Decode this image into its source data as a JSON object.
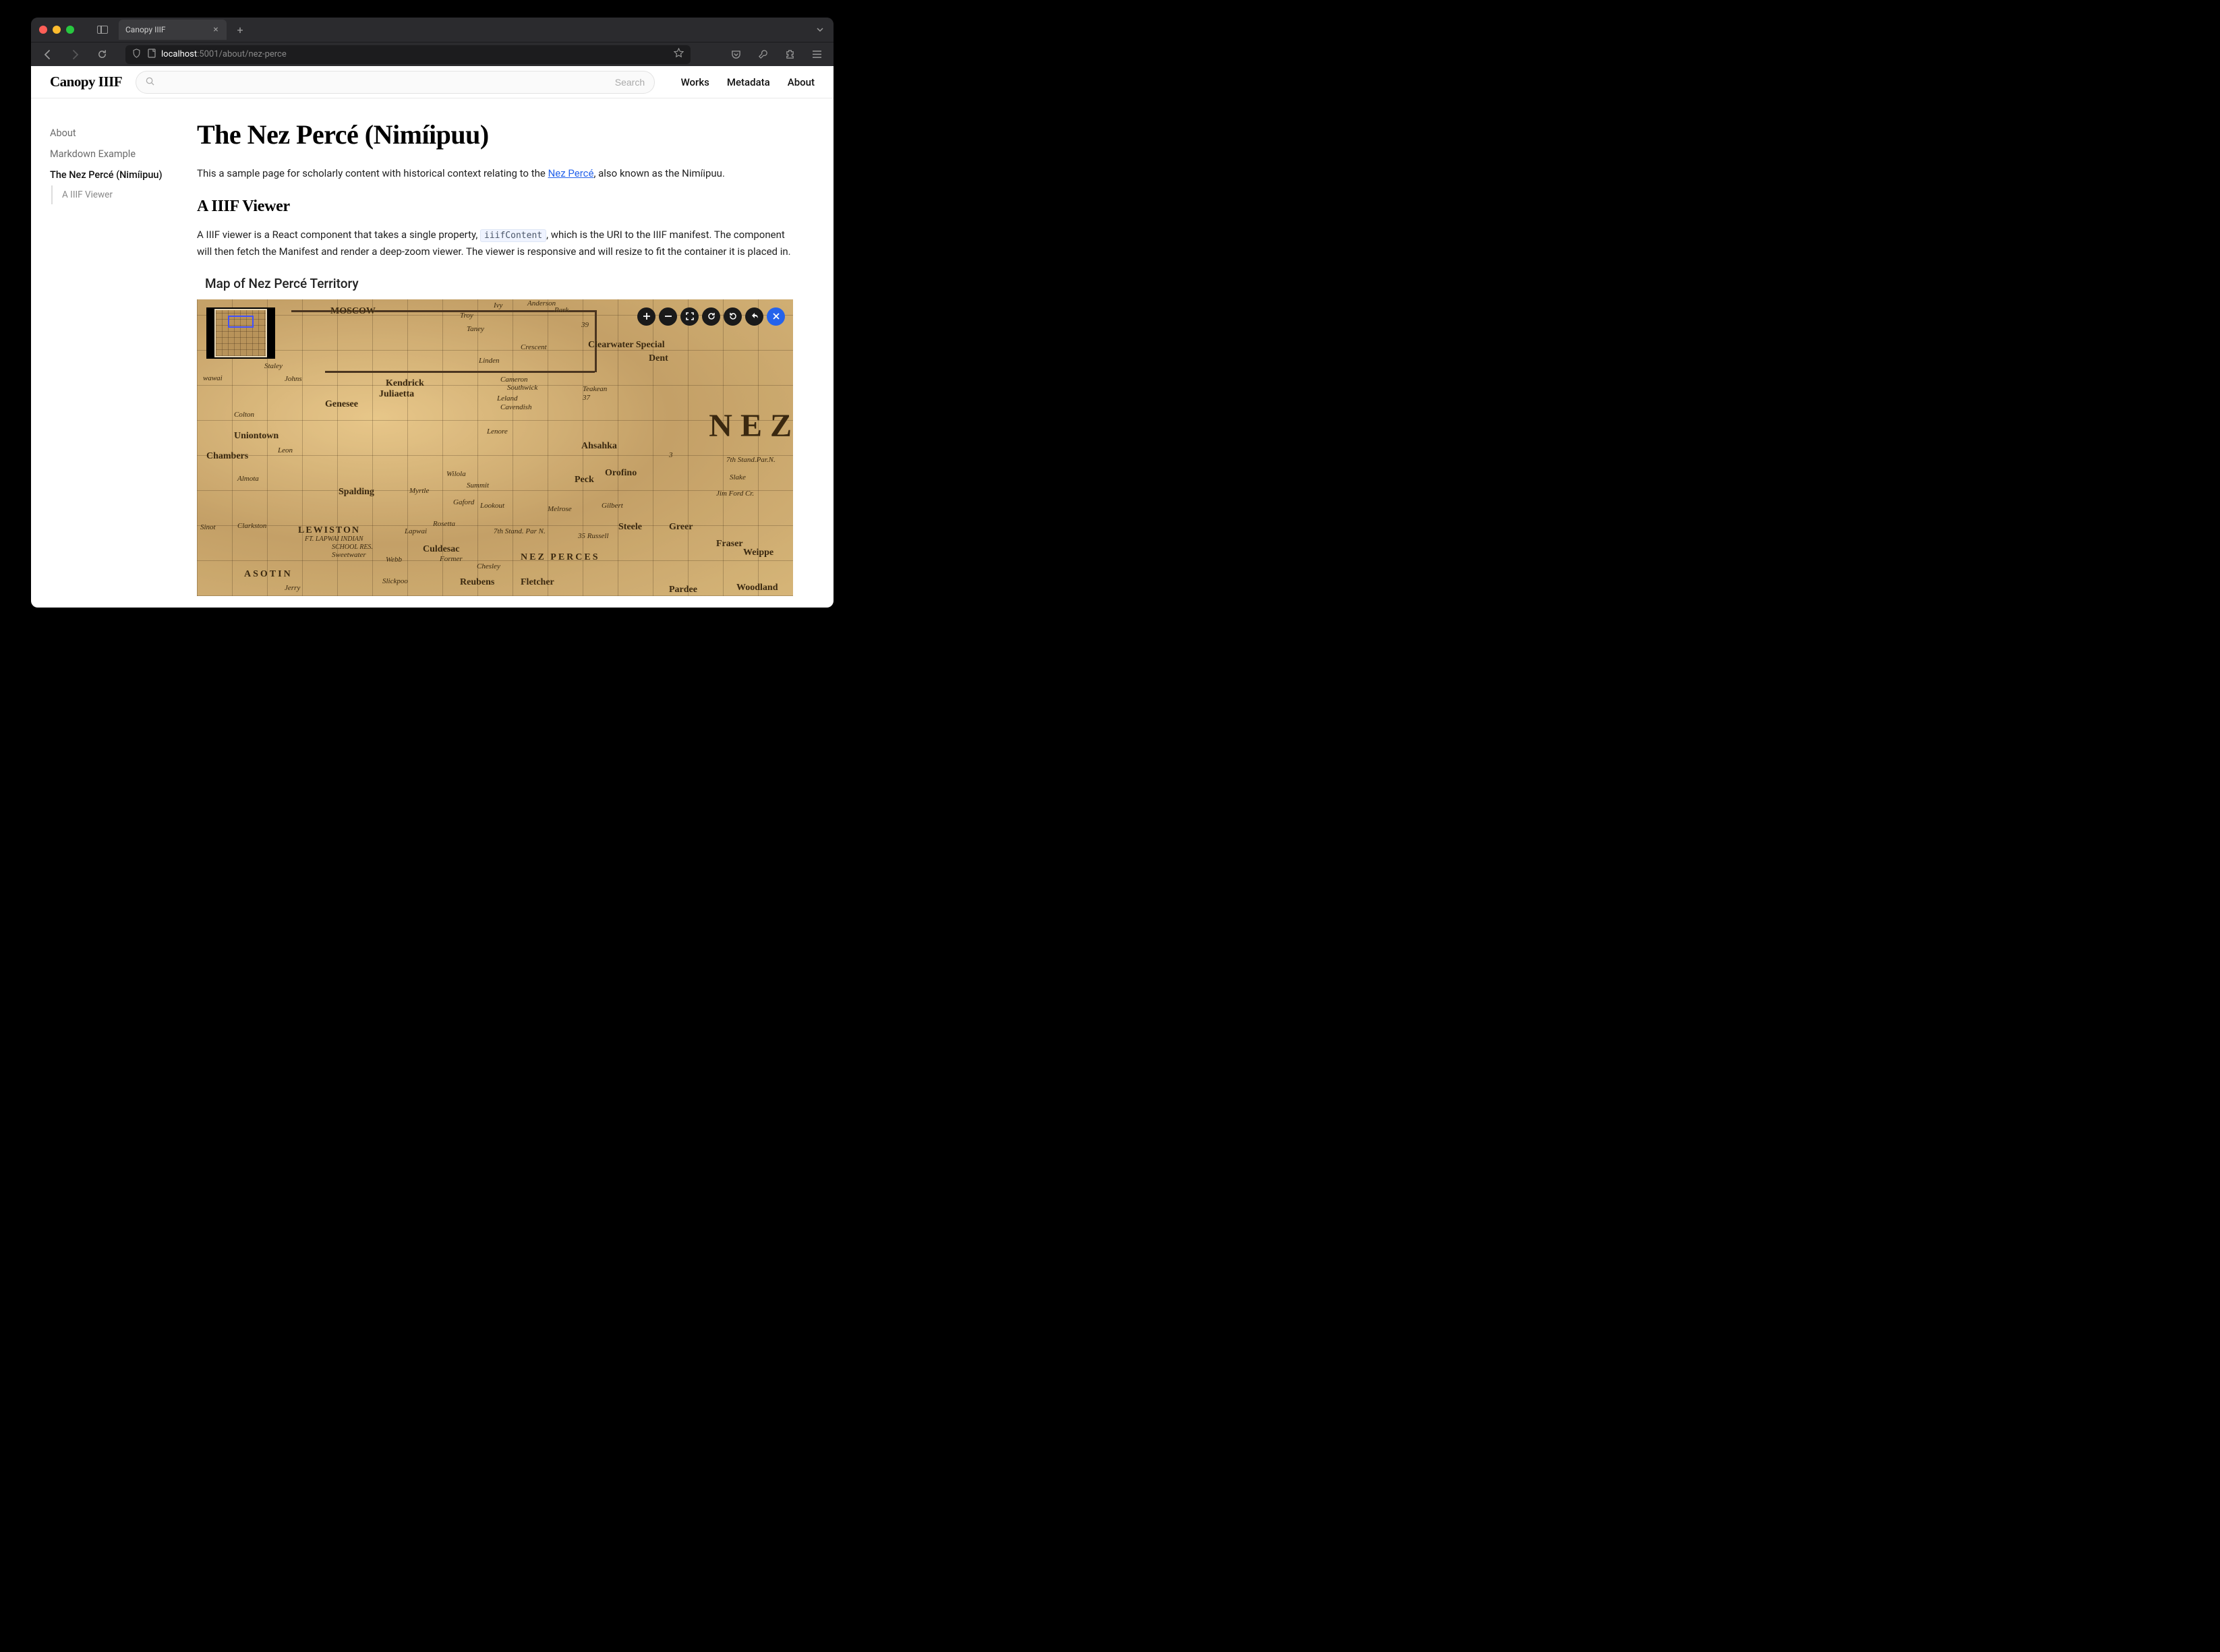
{
  "browser": {
    "tab_title": "Canopy IIIF",
    "url_host": "localhost",
    "url_port": ":5001",
    "url_path": "/about/nez-perce"
  },
  "header": {
    "logo": "Canopy IIIF",
    "search_placeholder": "Search",
    "nav": [
      "Works",
      "Metadata",
      "About"
    ]
  },
  "sidebar": {
    "items": [
      {
        "label": "About",
        "active": false
      },
      {
        "label": "Markdown Example",
        "active": false
      },
      {
        "label": "The Nez Percé (Nimíipuu)",
        "active": true
      }
    ],
    "subitems": [
      {
        "label": "A IIIF Viewer"
      }
    ]
  },
  "content": {
    "title": "The Nez Percé (Nimíipuu)",
    "intro_pre": "This a sample page for scholarly content with historical context relating to the ",
    "intro_link": "Nez Percé",
    "intro_post": ", also known as the Nimíipuu.",
    "section_heading": "A IIIF Viewer",
    "viewer_para_pre": "A IIIF viewer is a React component that takes a single property, ",
    "viewer_code": "iiifContent",
    "viewer_para_post": ", which is the URI to the IIIF manifest. The component will then fetch the Manifest and render a deep-zoom viewer. The viewer is responsive and will resize to fit the container it is placed in.",
    "viewer_title": "Map of Nez Percé Territory"
  },
  "map_labels": {
    "nez_big": "NEZ",
    "moscow": "MOSCOW",
    "troy": "Troy",
    "anderson": "Anderson",
    "park": "Park",
    "ivy": "Ivy",
    "taney": "Taney",
    "crescent": "Crescent",
    "clearwater_special": "Clearwater Special",
    "dent": "Dent",
    "linden": "Linden",
    "kendrick": "Kendrick",
    "juliaetta": "Juliaetta",
    "cameron": "Cameron",
    "southwick": "Southwick",
    "leland": "Leland",
    "cavendish": "Cavendish",
    "teakean": "Teakean",
    "genesee": "Genesee",
    "lenore": "Lenore",
    "ahsahka": "Ahsahka",
    "orofino": "Orofino",
    "uniontown": "Uniontown",
    "colton": "Colton",
    "chambers": "Chambers",
    "wawai": "wawai",
    "johns": "Johns",
    "staley": "Staley",
    "leon": "Leon",
    "wilola": "Wilola",
    "spalding": "Spalding",
    "myrtle": "Myrtle",
    "summit": "Summit",
    "peck": "Peck",
    "slake": "Slake",
    "gaford": "Gaford",
    "lookout": "Lookout",
    "melrose": "Melrose",
    "gilbert": "Gilbert",
    "rosetta": "Rosetta",
    "lewiston": "LEWISTON",
    "clarkston": "Clarkston",
    "lapwai": "Lapwai",
    "lapwai_res": "FT. LAPWAI INDIAN",
    "school_res": "SCHOOL RES.",
    "seventh_par": "7th Stand. Par N.",
    "russell": "35 Russell",
    "steele": "Steele",
    "greer": "Greer",
    "fraser": "Fraser",
    "weippe": "Weippe",
    "culdesac": "Culdesac",
    "sweetwater": "Sweetwater",
    "webb": "Webb",
    "former": "Former",
    "chesley": "Chesley",
    "nez_perces": "NEZ PERCES",
    "asotin": "ASOTIN",
    "slickpoo": "Slickpoo",
    "reubens": "Reubens",
    "fletcher": "Fletcher",
    "pardee": "Pardee",
    "woodland": "Woodland",
    "jerry": "Jerry",
    "sinot": "Sinot",
    "almota": "Almota",
    "seventh_n": "7th Stand.Par.N.",
    "jim_ford": "Jim Ford Cr.",
    "oro_3": "3",
    "num_37": "37",
    "num_39": "39"
  }
}
